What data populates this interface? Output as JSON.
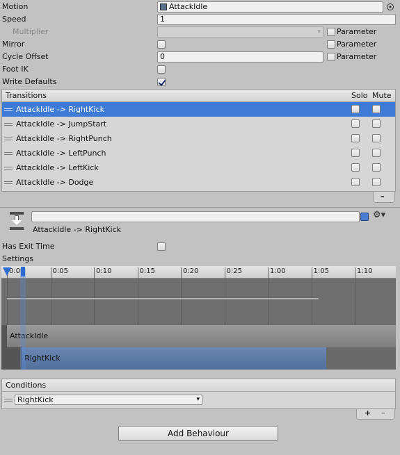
{
  "props": {
    "motion_label": "Motion",
    "motion_value": "AttackIdle",
    "speed_label": "Speed",
    "speed_value": "1",
    "multiplier_label": "Multiplier",
    "mirror_label": "Mirror",
    "cycle_offset_label": "Cycle Offset",
    "cycle_offset_value": "0",
    "foot_ik_label": "Foot IK",
    "write_defaults_label": "Write Defaults",
    "parameter_label": "Parameter"
  },
  "transitions": {
    "header": "Transitions",
    "solo_header": "Solo",
    "mute_header": "Mute",
    "items": [
      {
        "label": "AttackIdle -> RightKick"
      },
      {
        "label": "AttackIdle -> JumpStart"
      },
      {
        "label": "AttackIdle -> RightPunch"
      },
      {
        "label": "AttackIdle -> LeftPunch"
      },
      {
        "label": "AttackIdle -> LeftKick"
      },
      {
        "label": "AttackIdle -> Dodge"
      }
    ],
    "remove_label": "–"
  },
  "transition_detail": {
    "name": "AttackIdle -> RightKick",
    "has_exit_time_label": "Has Exit Time",
    "settings_label": "Settings"
  },
  "timeline": {
    "ticks": [
      "0:00",
      "0:05",
      "0:10",
      "0:15",
      "0:20",
      "0:25",
      "1:00",
      "1:05",
      "1:10"
    ],
    "source_state": "AttackIdle",
    "dest_state": "RightKick"
  },
  "conditions": {
    "header": "Conditions",
    "param_value": "RightKick",
    "add_label": "+",
    "remove_label": "–"
  },
  "add_behaviour_label": "Add Behaviour",
  "colors": {
    "selection": "#3e7bd6",
    "timeline_bg": "#6e6e6e",
    "source_bar": "#8c8c8c",
    "dest_bar": "#5e7aa6"
  }
}
